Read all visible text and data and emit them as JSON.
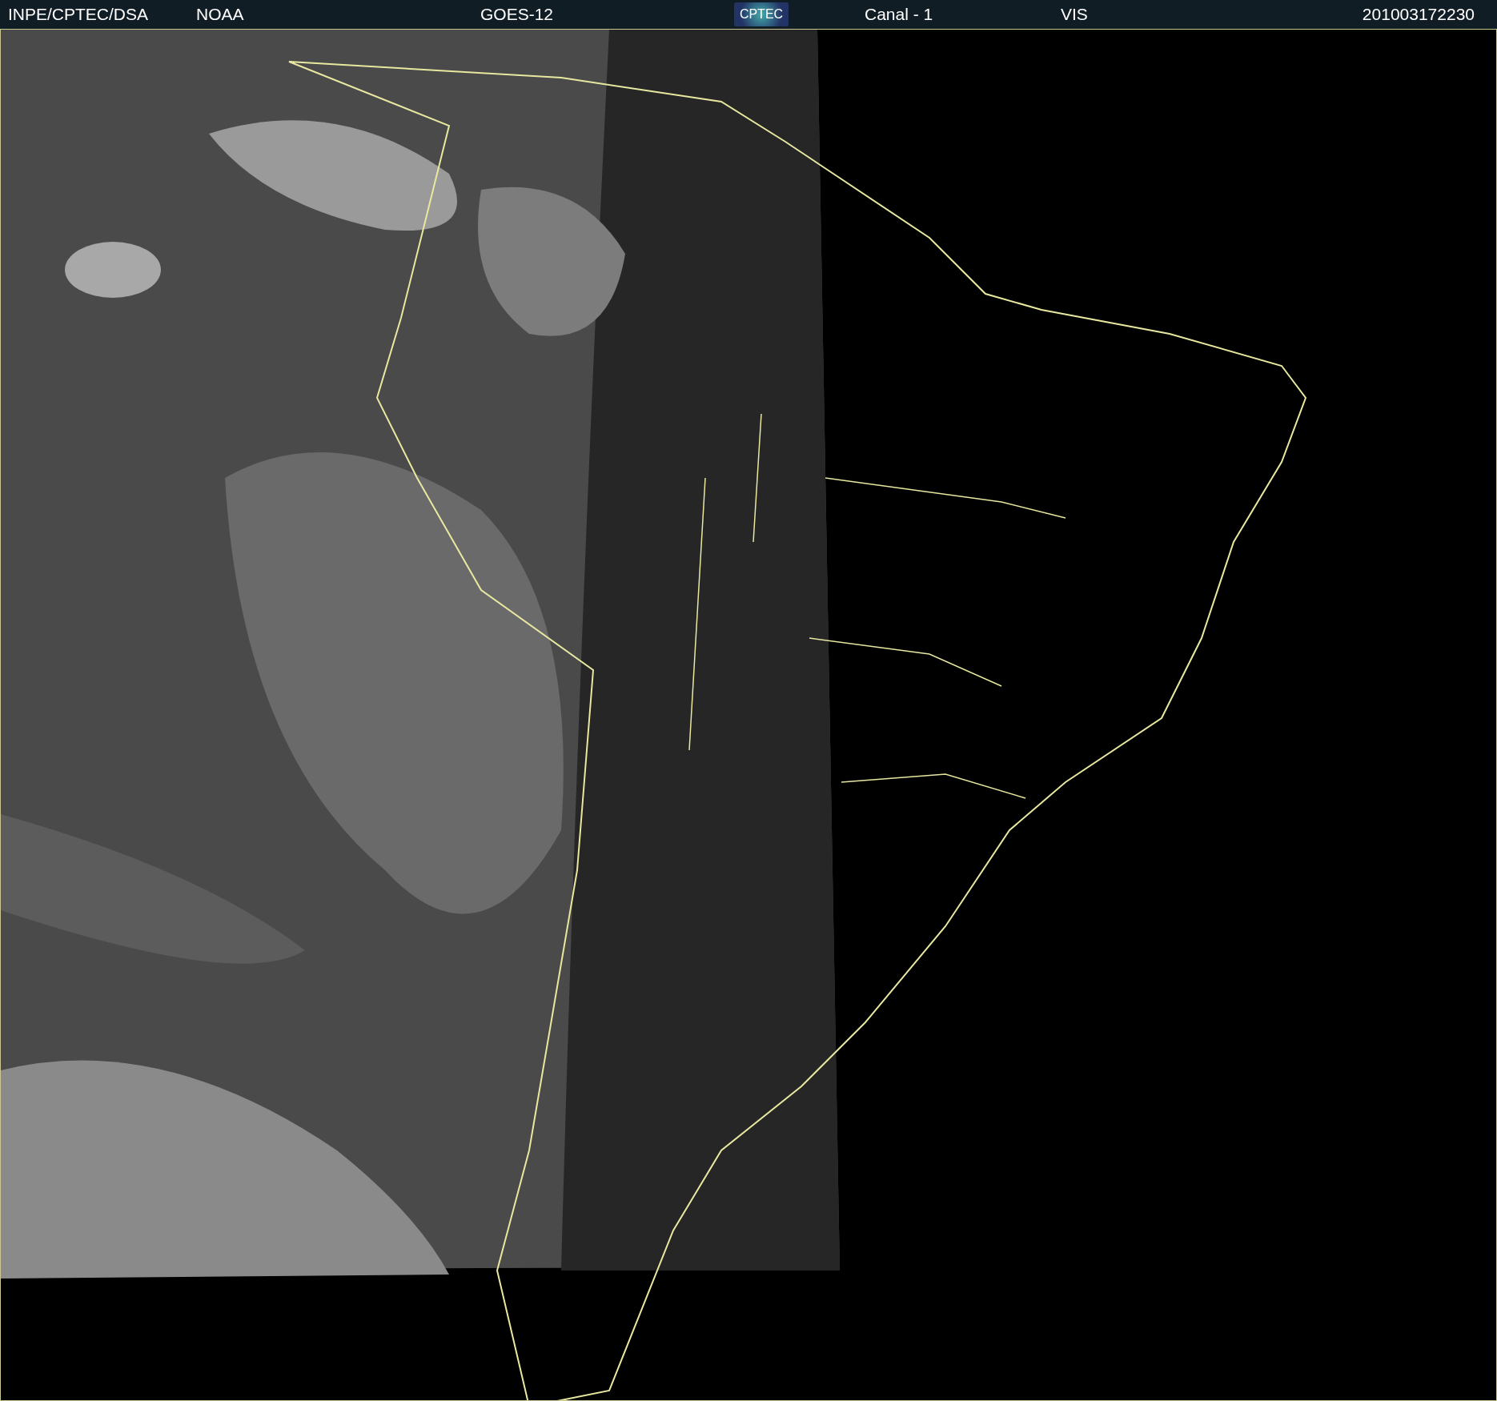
{
  "header": {
    "agency": "INPE/CPTEC/DSA",
    "source": "NOAA",
    "satellite": "GOES-12",
    "logo": "CPTEC",
    "channel": "Canal - 1",
    "band": "VIS",
    "timestamp": "201003172230"
  }
}
